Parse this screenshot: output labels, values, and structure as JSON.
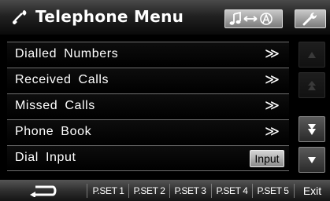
{
  "header": {
    "title": "Telephone Menu",
    "title_icon": "telephone-handset-icon",
    "audio_source_icon": "music-to-navigation-switch-icon",
    "setup_icon": "wrench-icon"
  },
  "menu": {
    "items": [
      {
        "label": "Dialled  Numbers",
        "action": "≫"
      },
      {
        "label": "Received  Calls",
        "action": "≫"
      },
      {
        "label": "Missed  Calls",
        "action": "≫"
      },
      {
        "label": "Phone  Book",
        "action": "≫"
      },
      {
        "label": "Dial  Input",
        "button": "Input"
      }
    ]
  },
  "scroll": {
    "page_up_icon": "double-up-arrow-icon",
    "up_icon": "up-arrow-icon",
    "page_down_icon": "double-down-arrow-icon",
    "down_icon": "down-arrow-icon"
  },
  "footer": {
    "back_icon": "return-arrow-icon",
    "presets": [
      "P.SET 1",
      "P.SET 2",
      "P.SET 3",
      "P.SET 4",
      "P.SET 5"
    ],
    "exit_label": "Exit"
  },
  "colors": {
    "background": "#000000",
    "header_gradient_top": "#4a4a4a",
    "row_border": "#6f6f6f",
    "button_silver": "#c9c9c9"
  }
}
